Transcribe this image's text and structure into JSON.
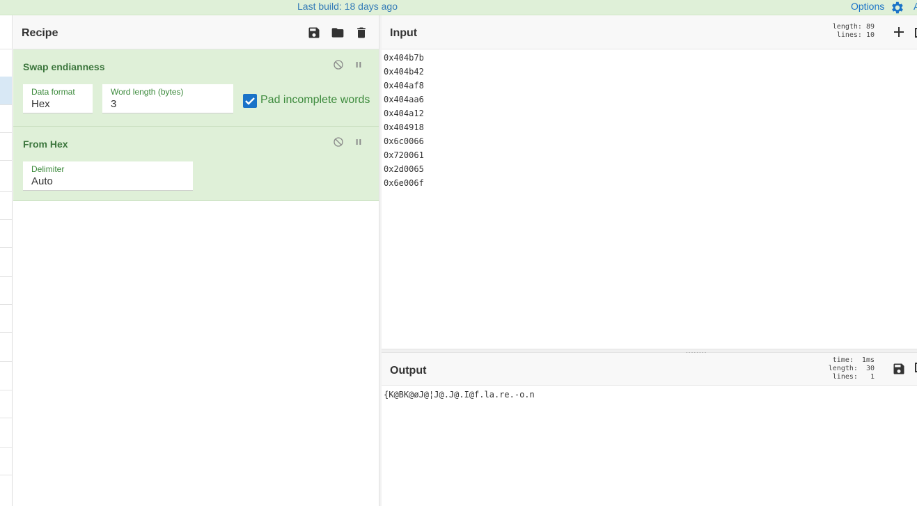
{
  "banner": {
    "build": "Last build: 18 days ago",
    "options": "Options",
    "cut_text": "A"
  },
  "recipe": {
    "title": "Recipe",
    "operations": [
      {
        "name": "Swap endianness",
        "fields": [
          {
            "label": "Data format",
            "value": "Hex"
          },
          {
            "label": "Word length (bytes)",
            "value": "3"
          }
        ],
        "checkbox": {
          "label": "Pad incomplete words",
          "checked": true
        }
      },
      {
        "name": "From Hex",
        "fields": [
          {
            "label": "Delimiter",
            "value": "Auto"
          }
        ]
      }
    ]
  },
  "input": {
    "title": "Input",
    "stats": {
      "length": "length: 89",
      "lines": "lines: 10"
    },
    "lines": [
      "0x404b7b",
      "0x404b42",
      "0x404af8",
      "0x404aa6",
      "0x404a12",
      "0x404918",
      "0x6c0066",
      "0x720061",
      "0x2d0065",
      "0x6e006f"
    ]
  },
  "output": {
    "title": "Output",
    "stats": {
      "time": "time:  1ms",
      "length": "length:  30",
      "lines": "lines:   1"
    },
    "text": "{K@BK@øJ@¦J@.J@.I@f.la.re.-o.n"
  },
  "colors": {
    "accent": "#1a73c8",
    "recipe_bg": "#dff0d8",
    "recipe_title": "#3c763d"
  }
}
